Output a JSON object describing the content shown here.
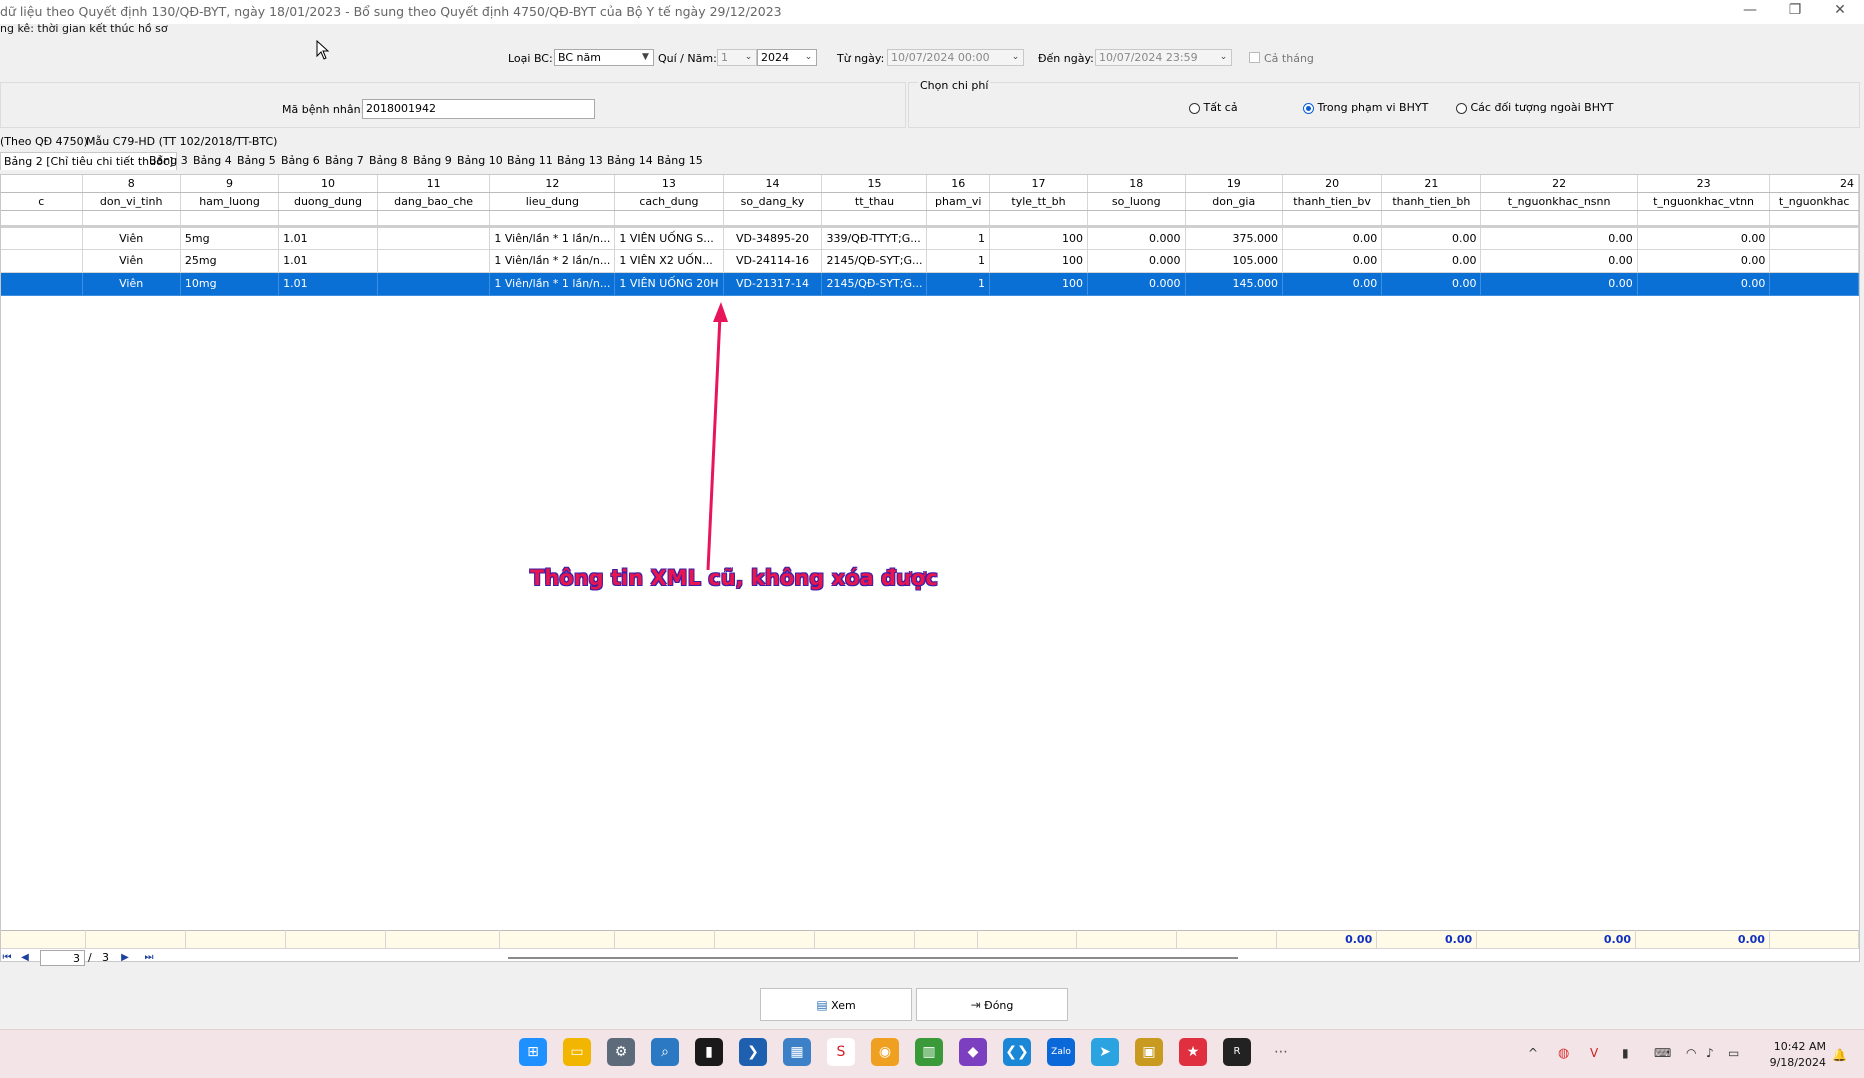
{
  "window": {
    "title": "dữ liệu theo Quyết định 130/QĐ-BYT, ngày 18/01/2023 - Bổ sung theo Quyết định 4750/QĐ-BYT của Bộ Y tế ngày 29/12/2023",
    "subtitle": "ng kê: thời gian kết thúc hồ sơ",
    "minimize": "—",
    "restore": "❐",
    "close": "✕"
  },
  "filters": {
    "loai_bc_label": "Loại BC:",
    "loai_bc_value": "BC năm",
    "qui_nam_label": "Quí / Năm:",
    "qui_value": "1",
    "nam_value": "2024",
    "tu_ngay_label": "Từ ngày:",
    "tu_ngay_value": "10/07/2024 00:00",
    "den_ngay_label": "Đến ngày:",
    "den_ngay_value": "10/07/2024 23:59",
    "ca_thang_label": "Cả tháng",
    "ma_benh_nhan_label": "Mã bệnh nhân:",
    "ma_benh_nhan_value": "2018001942"
  },
  "chon_chi_phi": {
    "title": "Chọn chi phí",
    "options": [
      "Tất cả",
      "Trong phạm vi BHYT",
      "Các đối tượng ngoài BHYT"
    ],
    "selected": "Trong phạm vi BHYT"
  },
  "top_tabs": [
    "(Theo QĐ 4750)",
    "Mẫu C79-HD (TT 102/2018/TT-BTC)"
  ],
  "sub_tabs": [
    "Bảng 2 [Chỉ tiêu chi tiết thuốc]",
    "Bảng 3",
    "Bảng 4",
    "Bảng 5",
    "Bảng 6",
    "Bảng 7",
    "Bảng 8",
    "Bảng 9",
    "Bảng 10",
    "Bảng 11",
    "Bảng 13",
    "Bảng 14",
    "Bảng 15"
  ],
  "grid": {
    "numbers": [
      "",
      "8",
      "9",
      "10",
      "11",
      "12",
      "13",
      "14",
      "15",
      "16",
      "17",
      "18",
      "19",
      "20",
      "21",
      "22",
      "23",
      "24"
    ],
    "headers": [
      "c",
      "don_vi_tinh",
      "ham_luong",
      "duong_dung",
      "dang_bao_che",
      "lieu_dung",
      "cach_dung",
      "so_dang_ky",
      "tt_thau",
      "pham_vi",
      "tyle_tt_bh",
      "so_luong",
      "don_gia",
      "thanh_tien_bv",
      "thanh_tien_bh",
      "t_nguonkhac_nsnn",
      "t_nguonkhac_vtnn",
      "t_nguonkhac"
    ],
    "rows": [
      [
        "",
        "Viên",
        "5mg",
        "1.01",
        "",
        "1 Viên/lần * 1 lần/n...",
        "1 VIÊN UỐNG S...",
        "VD-34895-20",
        "339/QĐ-TTYT;G...",
        "1",
        "100",
        "0.000",
        "375.000",
        "0.00",
        "0.00",
        "0.00",
        "0.00",
        ""
      ],
      [
        "",
        "Viên",
        "25mg",
        "1.01",
        "",
        "1 Viên/lần * 2 lần/n...",
        "1 VIÊN X2 UỐN...",
        "VD-24114-16",
        "2145/QĐ-SYT;G...",
        "1",
        "100",
        "0.000",
        "105.000",
        "0.00",
        "0.00",
        "0.00",
        "0.00",
        ""
      ],
      [
        "",
        "Viên",
        "10mg",
        "1.01",
        "",
        "1 Viên/lần * 1 lần/n...",
        "1 VIÊN UỐNG 20H",
        "VD-21317-14",
        "2145/QĐ-SYT;G...",
        "1",
        "100",
        "0.000",
        "145.000",
        "0.00",
        "0.00",
        "0.00",
        "0.00",
        ""
      ]
    ],
    "selected_row": 2,
    "footer": [
      "",
      "",
      "",
      "",
      "",
      "",
      "",
      "",
      "",
      "",
      "",
      "",
      "",
      "0.00",
      "0.00",
      "0.00",
      "0.00",
      ""
    ]
  },
  "pager": {
    "current": "3",
    "separator": "/",
    "total": "3"
  },
  "annotation": "Thông tin XML cũ, không xóa được",
  "buttons": {
    "xem": "Xem",
    "dong": "Đóng"
  },
  "taskbar": {
    "time": "10:42 AM",
    "date": "9/18/2024",
    "accent": "#0a70d6"
  }
}
